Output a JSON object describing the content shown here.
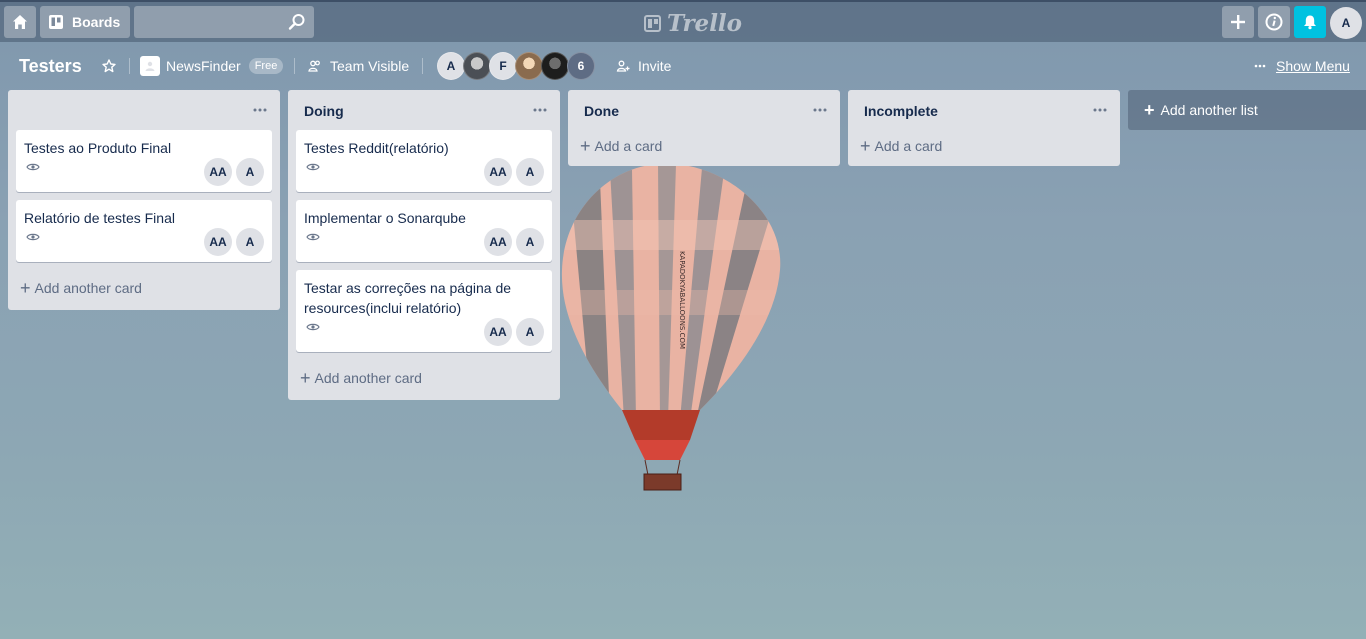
{
  "header": {
    "boards_label": "Boards",
    "search": {
      "value": "",
      "placeholder": ""
    },
    "logo_text": "Trello",
    "user_initial": "A",
    "colors": {
      "notification_button": "#00c2e0"
    }
  },
  "board": {
    "title": "Testers",
    "team_name": "NewsFinder",
    "plan_badge": "Free",
    "visibility": "Team Visible",
    "members": [
      "A",
      "",
      "F",
      "",
      ""
    ],
    "members_more": "6",
    "invite_label": "Invite",
    "show_menu_label": "Show Menu"
  },
  "lists": [
    {
      "title": "",
      "cards": [
        {
          "title": "Testes ao Produto Final",
          "members": [
            "AA",
            "A"
          ]
        },
        {
          "title": "Relatório de testes Final",
          "members": [
            "AA",
            "A"
          ]
        }
      ],
      "add_label": "Add another card"
    },
    {
      "title": "Doing",
      "cards": [
        {
          "title": "Testes Reddit(relatório)",
          "members": [
            "AA",
            "A"
          ]
        },
        {
          "title": "Implementar o Sonarqube",
          "members": [
            "AA",
            "A"
          ]
        },
        {
          "title": "Testar as correções na página de resources(inclui relatório)",
          "members": [
            "AA",
            "A"
          ]
        }
      ],
      "add_label": "Add another card"
    },
    {
      "title": "Done",
      "cards": [],
      "add_label": "Add a card"
    },
    {
      "title": "Incomplete",
      "cards": [],
      "add_label": "Add a card"
    }
  ],
  "add_list_label": "Add another list",
  "balloon_text": "KAPADOKYABALLOONS.COM"
}
